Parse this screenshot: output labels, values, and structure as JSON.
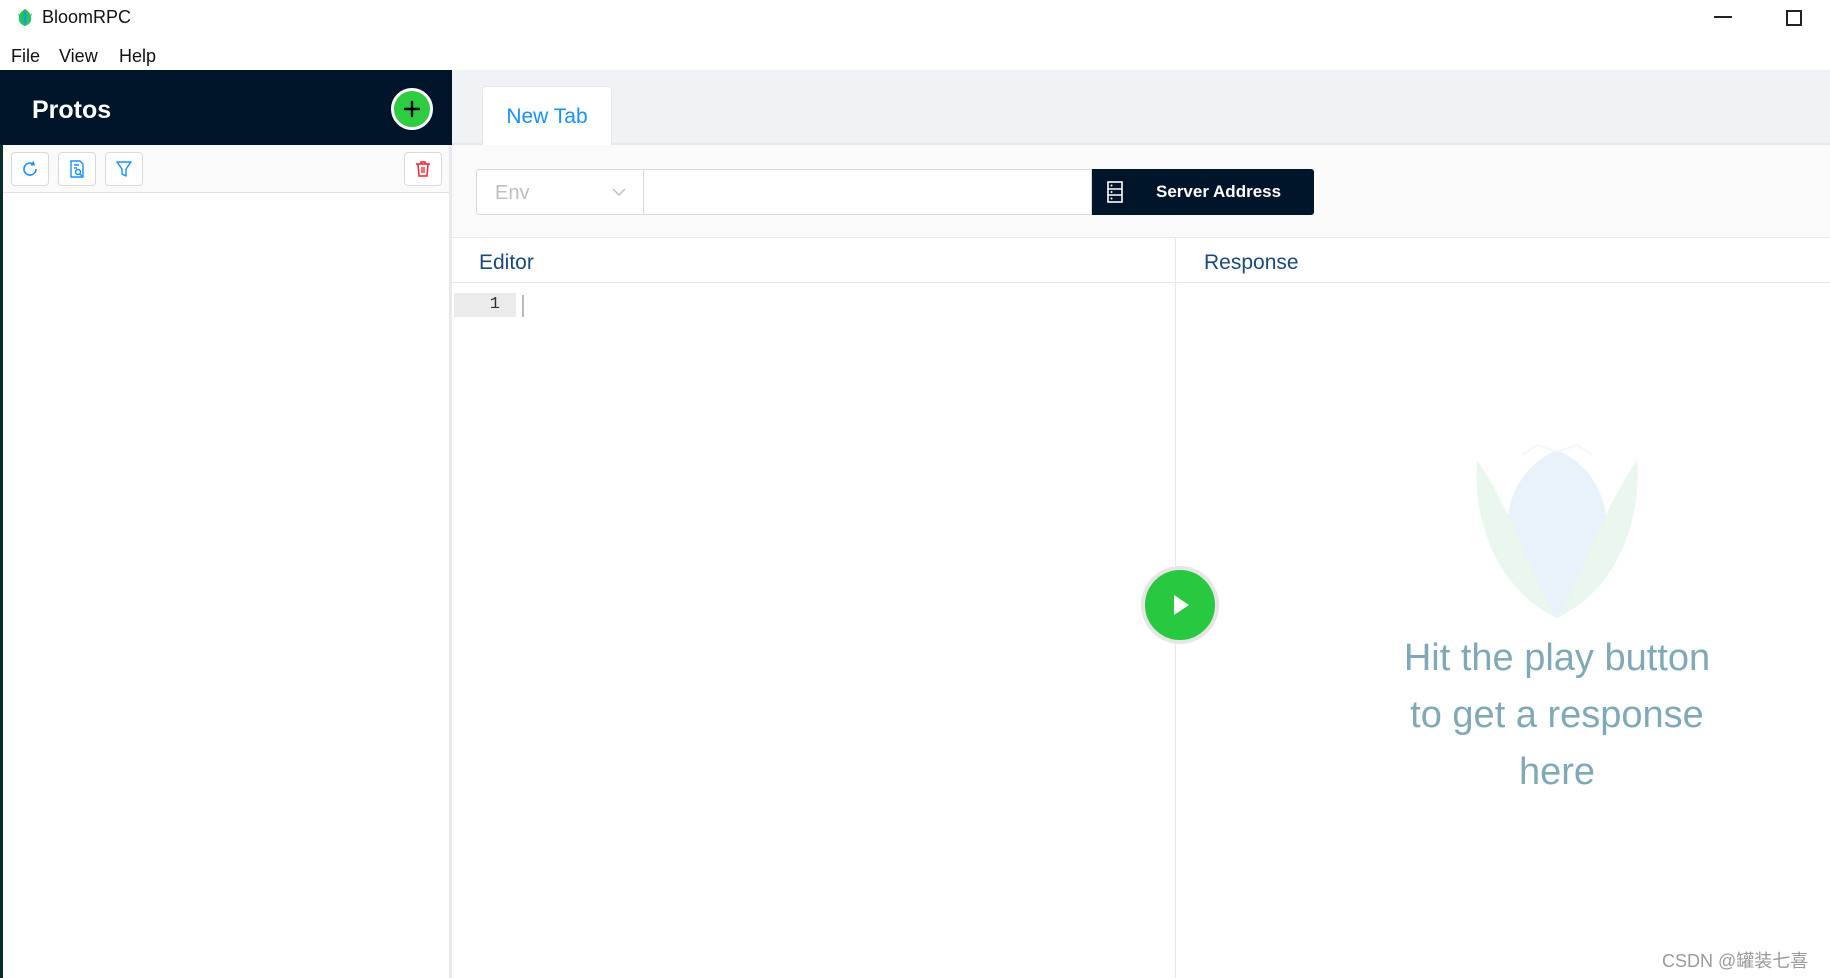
{
  "window": {
    "title": "BloomRPC"
  },
  "menu": {
    "items": [
      "File",
      "View",
      "Help"
    ]
  },
  "sidebar": {
    "title": "Protos"
  },
  "tabs": [
    {
      "label": "New Tab",
      "active": true
    }
  ],
  "address_bar": {
    "env_placeholder": "Env",
    "address_value": "",
    "server_button_label": "Server Address"
  },
  "editor": {
    "title": "Editor",
    "line_numbers": [
      "1"
    ]
  },
  "response": {
    "title": "Response",
    "hint_lines": [
      "Hit the play button",
      "to get a response",
      "here"
    ]
  },
  "watermark": "CSDN @罐装七喜",
  "colors": {
    "sidebar_header_bg": "#001529",
    "accent_green": "#28c940",
    "tab_text": "#1890ff",
    "hint_text": "#7fa9b7",
    "delete_icon": "#f5222d"
  },
  "icons": [
    "bloomrpc-logo",
    "plus-icon",
    "refresh-icon",
    "file-search-icon",
    "filter-icon",
    "trash-icon",
    "chevron-down-icon",
    "database-icon",
    "play-icon"
  ]
}
